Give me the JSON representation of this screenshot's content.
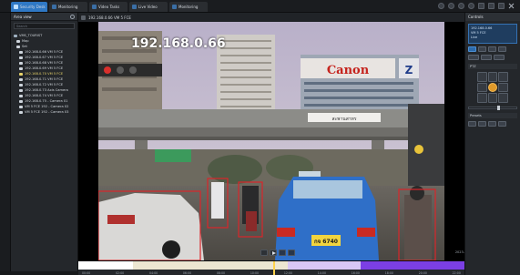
{
  "tabs": [
    {
      "label": "Security Desk",
      "active": true
    },
    {
      "label": "Monitoring",
      "active": false
    },
    {
      "label": "Video Tasks",
      "active": false
    },
    {
      "label": "Live Video",
      "active": false
    },
    {
      "label": "Monitoring",
      "active": false
    }
  ],
  "sidebar": {
    "title": "Area view",
    "search_placeholder": "Search",
    "items": [
      {
        "label": "VMS_TOURIST",
        "level": 0,
        "selected": false
      },
      {
        "label": "Map",
        "level": 1,
        "selected": false
      },
      {
        "label": "Set",
        "level": 1,
        "selected": false
      },
      {
        "label": "192.168.0.66 VM 5 FCE",
        "level": 2,
        "selected": false
      },
      {
        "label": "192.168.0.67 VM 5 FCE",
        "level": 2,
        "selected": false
      },
      {
        "label": "192.168.0.68 VM 5 FCE",
        "level": 2,
        "selected": false
      },
      {
        "label": "192.168.0.69 VM 5 FCE",
        "level": 2,
        "selected": false
      },
      {
        "label": "192.168.0.70 VM 5 FCE",
        "level": 2,
        "selected": true
      },
      {
        "label": "192.168.0.71 VM 5 FCE",
        "level": 2,
        "selected": false
      },
      {
        "label": "192.168.0.72 VM 5 FCE",
        "level": 2,
        "selected": false
      },
      {
        "label": "192.168.0.73 Axis Camera",
        "level": 2,
        "selected": false
      },
      {
        "label": "192.168.0.74 VM 5 FCE",
        "level": 2,
        "selected": false
      },
      {
        "label": "192.168.0.75 - Camera 01",
        "level": 2,
        "selected": false
      },
      {
        "label": "VM 5 FCE 192 - Camera 02",
        "level": 2,
        "selected": false
      },
      {
        "label": "VM 5 FCE 192 - Camera 03",
        "level": 2,
        "selected": false
      }
    ]
  },
  "video": {
    "header_label": "192.168.0.66 VM 5 FCE",
    "ip_overlay": "192.168.0.66",
    "plate_text": "กจ 6740",
    "sign_canon": "Canon",
    "sign_z": "Z",
    "sign_bridge": "สะพานสาทร",
    "timestamp_label": "2023-03-08 12:00:00"
  },
  "rpanel": {
    "title": "Controls",
    "info_lines": [
      "192.168.0.66",
      "VM 5 FCE",
      "Live"
    ],
    "section_ptz": "PTZ",
    "section_presets": "Presets"
  },
  "timeline": {
    "ticks": [
      "00:00",
      "02:00",
      "04:00",
      "06:00",
      "08:00",
      "10:00",
      "12:00",
      "14:00",
      "16:00",
      "18:00",
      "20:00",
      "22:00"
    ]
  },
  "colors": {
    "accent": "#2f78c4",
    "detection_box": "#d9262a",
    "selected_item": "#e7d36a",
    "timeline_motion": "#7b3fe4"
  }
}
